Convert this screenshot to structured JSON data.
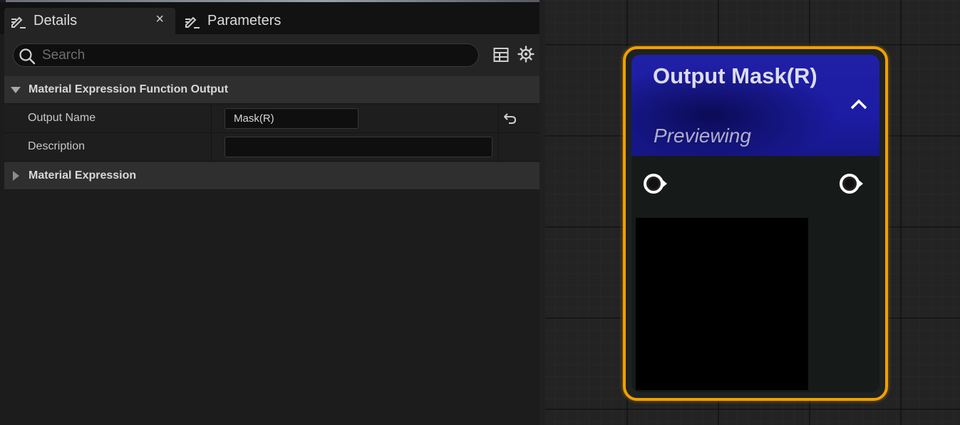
{
  "details_panel": {
    "tabs": [
      {
        "label": "Details",
        "icon": "edit-pencil-icon",
        "active": true,
        "closable": true
      },
      {
        "label": "Parameters",
        "icon": "edit-pencil-icon",
        "active": false
      }
    ],
    "close_symbol": "×",
    "search": {
      "placeholder": "Search",
      "value": ""
    },
    "toolbar_icons": [
      "table-view-icon",
      "settings-icon"
    ],
    "categories": [
      {
        "label": "Material Expression Function Output",
        "expanded": true,
        "properties": [
          {
            "label": "Output Name",
            "value": "Mask(R)",
            "has_reset": true
          },
          {
            "label": "Description",
            "value": ""
          }
        ]
      },
      {
        "label": "Material Expression",
        "expanded": false
      }
    ]
  },
  "graph": {
    "node": {
      "title": "Output Mask(R)",
      "subtitle": "Previewing",
      "colors": {
        "border": "#f0a000",
        "header": "#1f1fa4",
        "body": "#161a18",
        "preview": "#000000"
      },
      "pins": [
        "input-pin-icon",
        "output-pin-icon"
      ]
    }
  }
}
